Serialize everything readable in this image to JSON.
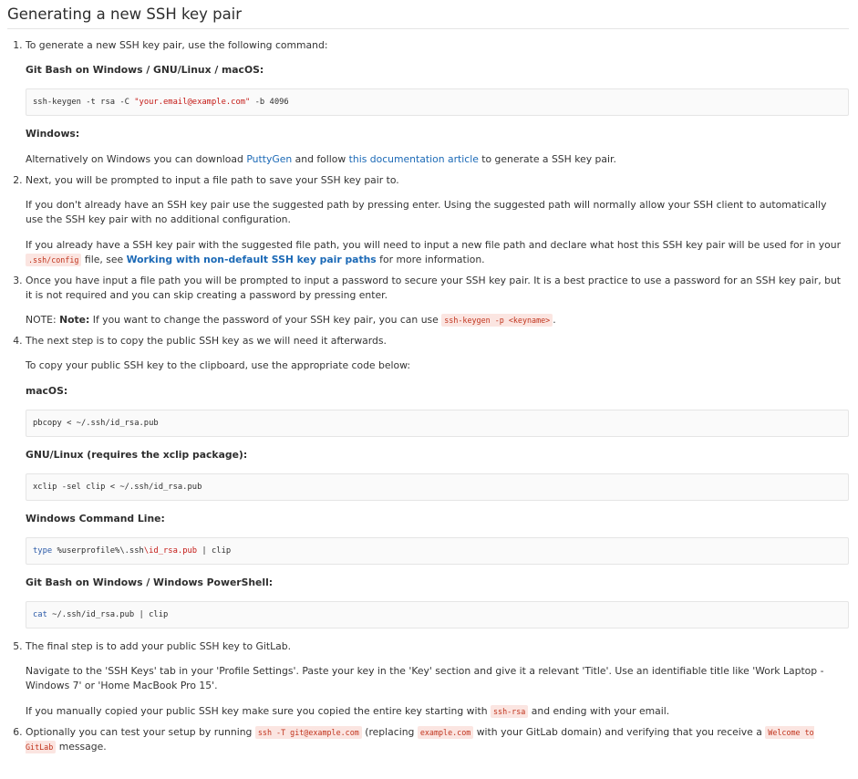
{
  "title": "Generating a new SSH key pair",
  "steps": [
    {
      "number": "1.",
      "intro": "To generate a new SSH key pair, use the following command:",
      "label_gitbash": "Git Bash on Windows / GNU/Linux / macOS:",
      "code_pre": "ssh-keygen -t rsa -C ",
      "code_str": "\"your.email@example.com\"",
      "code_post": " -b 4096",
      "label_windows": "Windows:",
      "alt_pre": "Alternatively on Windows you can download ",
      "alt_link1": "PuttyGen",
      "alt_mid": " and follow ",
      "alt_link2": "this documentation article",
      "alt_post": " to generate a SSH key pair."
    },
    {
      "number": "2.",
      "p1": "Next, you will be prompted to input a file path to save your SSH key pair to.",
      "p2": "If you don't already have an SSH key pair use the suggested path by pressing enter. Using the suggested path will normally allow your SSH client to automatically use the SSH key pair with no additional configuration.",
      "p3_pre": "If you already have a SSH key pair with the suggested file path, you will need to input a new file path and declare what host this SSH key pair will be used for in your ",
      "p3_code": ".ssh/config",
      "p3_mid": " file, see ",
      "p3_link": "Working with non-default SSH key pair paths",
      "p3_post": " for more information."
    },
    {
      "number": "3.",
      "p1": "Once you have input a file path you will be prompted to input a password to secure your SSH key pair. It is a best practice to use a password for an SSH key pair, but it is not required and you can skip creating a password by pressing enter.",
      "note_pre": "NOTE: ",
      "note_bold": "Note:",
      "note_text": " If you want to change the password of your SSH key pair, you can use ",
      "note_code": "ssh-keygen -p <keyname>",
      "note_post": "."
    },
    {
      "number": "4.",
      "p1": "The next step is to copy the public SSH key as we will need it afterwards.",
      "p2": "To copy your public SSH key to the clipboard, use the appropriate code below:",
      "label_macos": "macOS:",
      "code_macos": "pbcopy < ~/.ssh/id_rsa.pub",
      "label_linux": "GNU/Linux (requires the xclip package):",
      "code_linux": "xclip -sel clip < ~/.ssh/id_rsa.pub",
      "label_wincmd": "Windows Command Line:",
      "code_wincmd_kw": "type",
      "code_wincmd_mid": " %userprofile%\\.ssh",
      "code_wincmd_path": "\\id_rsa.pub",
      "code_wincmd_post": " | clip",
      "label_ps": "Git Bash on Windows / Windows PowerShell:",
      "code_ps_kw": "cat",
      "code_ps_post": " ~/.ssh/id_rsa.pub | clip"
    },
    {
      "number": "5.",
      "p1": "The final step is to add your public SSH key to GitLab.",
      "p2": "Navigate to the 'SSH Keys' tab in your 'Profile Settings'. Paste your key in the 'Key' section and give it a relevant 'Title'. Use an identifiable title like 'Work Laptop - Windows 7' or 'Home MacBook Pro 15'.",
      "p3_pre": "If you manually copied your public SSH key make sure you copied the entire key starting with ",
      "p3_code": "ssh-rsa",
      "p3_post": " and ending with your email."
    },
    {
      "number": "6.",
      "p_pre": "Optionally you can test your setup by running ",
      "p_code1": "ssh -T git@example.com",
      "p_mid1": " (replacing ",
      "p_code2": "example.com",
      "p_mid2": " with your GitLab domain) and verifying that you receive a ",
      "p_code3": "Welcome to GitLab",
      "p_post": " message."
    }
  ],
  "colors": {
    "link": "#1b69b6",
    "inline_code_text": "#c0341d",
    "inline_code_bg": "#fbe5e1",
    "code_block_bg": "#fafafa",
    "code_string": "#c41a16",
    "code_keyword": "#2b5aa8"
  }
}
